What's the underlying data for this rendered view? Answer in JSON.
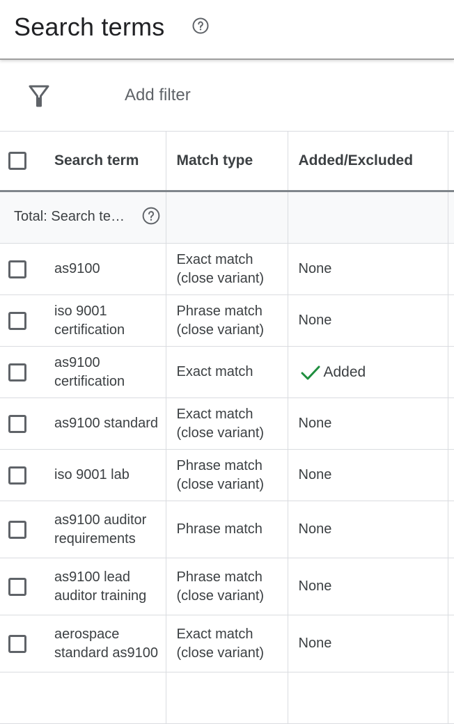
{
  "header": {
    "title": "Search terms",
    "help_icon": "help-circle-icon"
  },
  "filter_bar": {
    "filter_icon": "filter-funnel-icon",
    "add_filter_label": "Add filter"
  },
  "table": {
    "columns": [
      {
        "key": "select",
        "label": ""
      },
      {
        "key": "search_term",
        "label": "Search term"
      },
      {
        "key": "match_type",
        "label": "Match type"
      },
      {
        "key": "added_excluded",
        "label": "Added/Excluded"
      }
    ],
    "total_row": {
      "label": "Total: Search te…",
      "help_icon": "help-circle-icon"
    },
    "rows": [
      {
        "search_term": "as9100",
        "match_type": "Exact match (close variant)",
        "added_excluded": "None",
        "checked": false
      },
      {
        "search_term": "iso 9001 certification",
        "match_type": "Phrase match (close variant)",
        "added_excluded": "None",
        "checked": false
      },
      {
        "search_term": "as9100 certification",
        "match_type": "Exact match",
        "added_excluded": "Added",
        "status_icon": "check-icon",
        "checked": false
      },
      {
        "search_term": "as9100 standard",
        "match_type": "Exact match (close variant)",
        "added_excluded": "None",
        "checked": false
      },
      {
        "search_term": "iso 9001 lab",
        "match_type": "Phrase match (close variant)",
        "added_excluded": "None",
        "checked": false
      },
      {
        "search_term": "as9100 auditor requirements",
        "match_type": "Phrase match",
        "added_excluded": "None",
        "checked": false
      },
      {
        "search_term": "as9100 lead auditor training",
        "match_type": "Phrase match (close variant)",
        "added_excluded": "None",
        "checked": false
      },
      {
        "search_term": "aerospace standard as9100",
        "match_type": "Exact match (close variant)",
        "added_excluded": "None",
        "checked": false
      }
    ]
  },
  "colors": {
    "added_check": "#1e8e3e",
    "header_divider": "#9e9e9e",
    "grid_line": "#dadce0",
    "total_row_bg": "#f8f9fa"
  }
}
